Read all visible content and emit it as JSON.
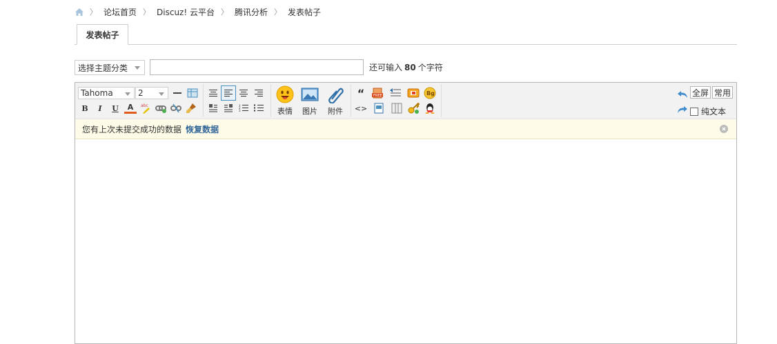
{
  "breadcrumb": {
    "items": [
      "论坛首页",
      "Discuz! 云平台",
      "腾讯分析"
    ],
    "current": "发表帖子",
    "separator": "〉"
  },
  "tab": {
    "label": "发表帖子"
  },
  "subject": {
    "category_selected": "选择主题分类",
    "input_value": "",
    "limit_prefix": "还可输入",
    "limit_count": "80",
    "limit_suffix": "个字符"
  },
  "toolbar": {
    "font_family": "Tahoma",
    "font_size": "2",
    "bold": "B",
    "italic": "I",
    "underline": "U",
    "text_color": "A",
    "emoji_label": "表情",
    "image_label": "图片",
    "attach_label": "附件",
    "quote_glyph": "“",
    "code_glyph": "<>",
    "fullscreen_label": "全屏",
    "common_label": "常用",
    "plaintext_label": "纯文本",
    "bg_badge": "Bg"
  },
  "notice": {
    "text": "您有上次未提交成功的数据",
    "restore_label": "恢复数据"
  },
  "colors": {
    "accent": "#336699",
    "notice_bg": "#fefce8",
    "toolbar_bg": "#f2f2f2"
  }
}
